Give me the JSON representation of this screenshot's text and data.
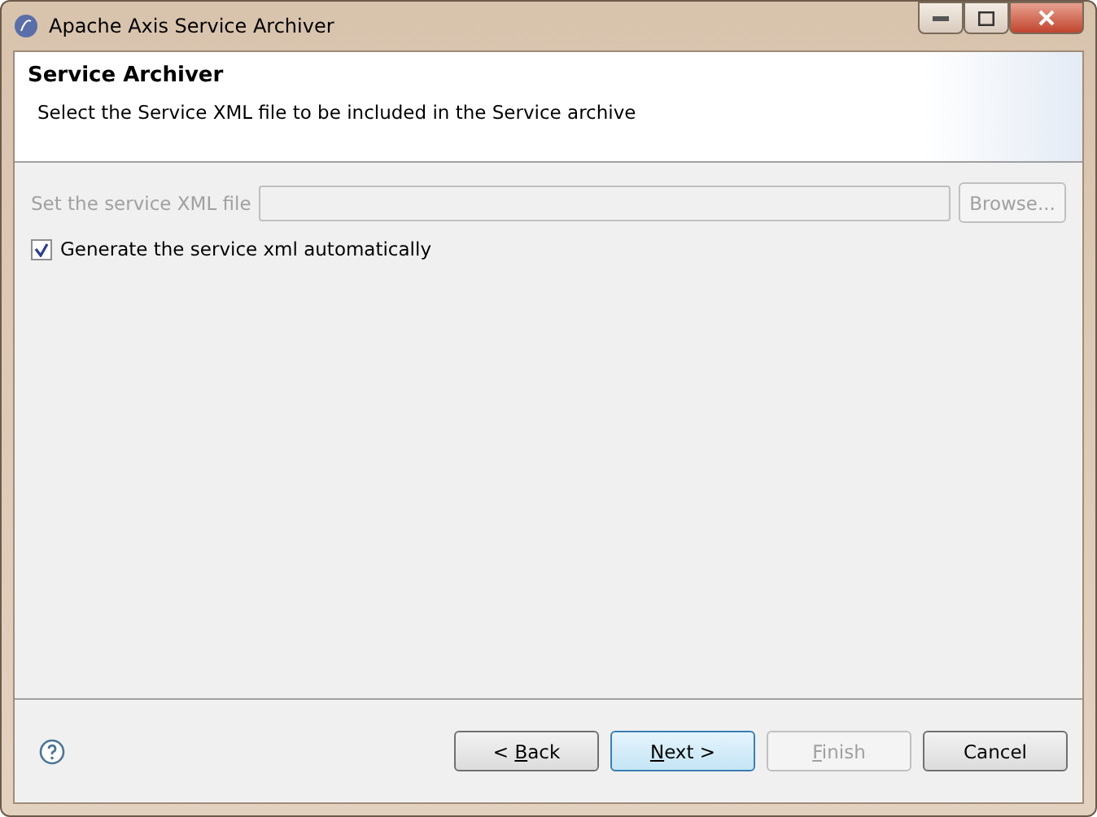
{
  "window": {
    "title": "Apache Axis Service Archiver"
  },
  "header": {
    "title": "Service Archiver",
    "description": "Select the Service XML file to be included in the Service archive"
  },
  "xml_file": {
    "label": "Set the service XML file",
    "disabled": true,
    "browse": "Browse..."
  },
  "generate_checkbox": {
    "label": "Generate the service xml automatically",
    "checked": true
  },
  "buttons": [
    {
      "pre": "< ",
      "key": "B",
      "post": "ack",
      "disabled": false,
      "selected": false
    },
    {
      "key": "N",
      "post": "ext >",
      "disabled": false,
      "selected": true
    },
    {
      "key": "F",
      "post": "inish",
      "disabled": true,
      "selected": false
    },
    {
      "pre": "Cancel",
      "disabled": false,
      "selected": false
    }
  ]
}
